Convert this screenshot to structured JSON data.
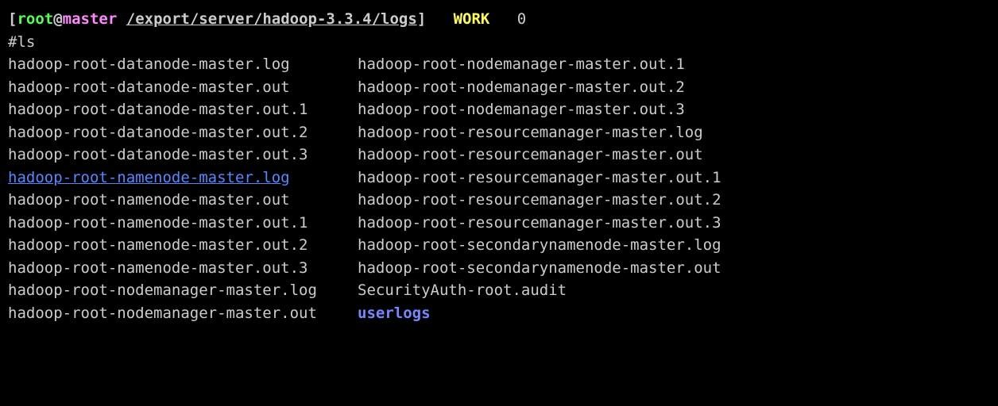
{
  "prompt": {
    "bracket_open": "[",
    "user": "root",
    "at": "@",
    "host": "master",
    "path": "/export/server/hadoop-3.3.4/logs",
    "bracket_close": "]",
    "work": "WORK",
    "number": "0"
  },
  "command": "#ls",
  "column1": [
    {
      "text": "hadoop-root-datanode-master.log",
      "type": "file"
    },
    {
      "text": "hadoop-root-datanode-master.out",
      "type": "file"
    },
    {
      "text": "hadoop-root-datanode-master.out.1",
      "type": "file"
    },
    {
      "text": "hadoop-root-datanode-master.out.2",
      "type": "file"
    },
    {
      "text": "hadoop-root-datanode-master.out.3",
      "type": "file"
    },
    {
      "text": "hadoop-root-namenode-master.log",
      "type": "symlink"
    },
    {
      "text": "hadoop-root-namenode-master.out",
      "type": "file"
    },
    {
      "text": "hadoop-root-namenode-master.out.1",
      "type": "file"
    },
    {
      "text": "hadoop-root-namenode-master.out.2",
      "type": "file"
    },
    {
      "text": "hadoop-root-namenode-master.out.3",
      "type": "file"
    },
    {
      "text": "hadoop-root-nodemanager-master.log",
      "type": "file"
    },
    {
      "text": "hadoop-root-nodemanager-master.out",
      "type": "file"
    }
  ],
  "column2": [
    {
      "text": "hadoop-root-nodemanager-master.out.1",
      "type": "file"
    },
    {
      "text": "hadoop-root-nodemanager-master.out.2",
      "type": "file"
    },
    {
      "text": "hadoop-root-nodemanager-master.out.3",
      "type": "file"
    },
    {
      "text": "hadoop-root-resourcemanager-master.log",
      "type": "file"
    },
    {
      "text": "hadoop-root-resourcemanager-master.out",
      "type": "file"
    },
    {
      "text": "hadoop-root-resourcemanager-master.out.1",
      "type": "file"
    },
    {
      "text": "hadoop-root-resourcemanager-master.out.2",
      "type": "file"
    },
    {
      "text": "hadoop-root-resourcemanager-master.out.3",
      "type": "file"
    },
    {
      "text": "hadoop-root-secondarynamenode-master.log",
      "type": "file"
    },
    {
      "text": "hadoop-root-secondarynamenode-master.out",
      "type": "file"
    },
    {
      "text": "SecurityAuth-root.audit",
      "type": "file"
    },
    {
      "text": "userlogs",
      "type": "directory"
    }
  ]
}
